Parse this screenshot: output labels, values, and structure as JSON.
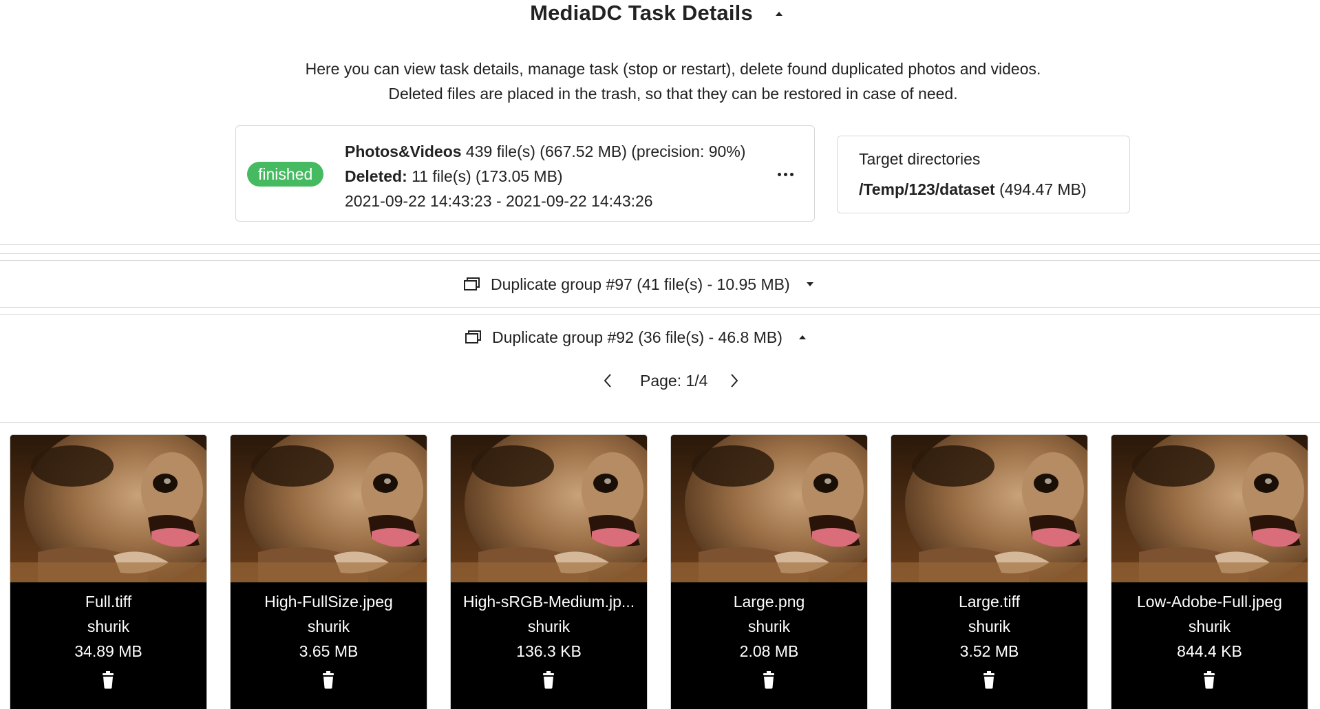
{
  "header": {
    "title": "MediaDC Task Details"
  },
  "description": {
    "line1": "Here you can view task details, manage task (stop or restart), delete found duplicated photos and videos.",
    "line2": "Deleted files are placed in the trash, so that they can be restored in case of need."
  },
  "task": {
    "status": "finished",
    "status_color": "#46ba61",
    "type_label": "Photos&Videos",
    "type_info": " 439 file(s) (667.52 MB) (precision: 90%)",
    "deleted_label": "Deleted:",
    "deleted_info": " 11 file(s) (173.05 MB)",
    "time_range": "2021-09-22 14:43:23 - 2021-09-22 14:43:26"
  },
  "targets": {
    "title": "Target directories",
    "dir_path": "/Temp/123/dataset",
    "dir_size": " (494.47 MB)"
  },
  "groups": [
    {
      "label": "Duplicate group #97 (41 file(s) - 10.95 MB)",
      "expanded": false
    },
    {
      "label": "Duplicate group #92 (36 file(s) - 46.8 MB)",
      "expanded": true
    }
  ],
  "pager": {
    "label": "Page: 1/4"
  },
  "files": [
    {
      "name": "Full.tiff",
      "owner": "shurik",
      "size": "34.89 MB"
    },
    {
      "name": "High-FullSize.jpeg",
      "owner": "shurik",
      "size": "3.65 MB"
    },
    {
      "name": "High-sRGB-Medium.jp...",
      "owner": "shurik",
      "size": "136.3 KB"
    },
    {
      "name": "Large.png",
      "owner": "shurik",
      "size": "2.08 MB"
    },
    {
      "name": "Large.tiff",
      "owner": "shurik",
      "size": "3.52 MB"
    },
    {
      "name": "Low-Adobe-Full.jpeg",
      "owner": "shurik",
      "size": "844.4 KB"
    }
  ]
}
